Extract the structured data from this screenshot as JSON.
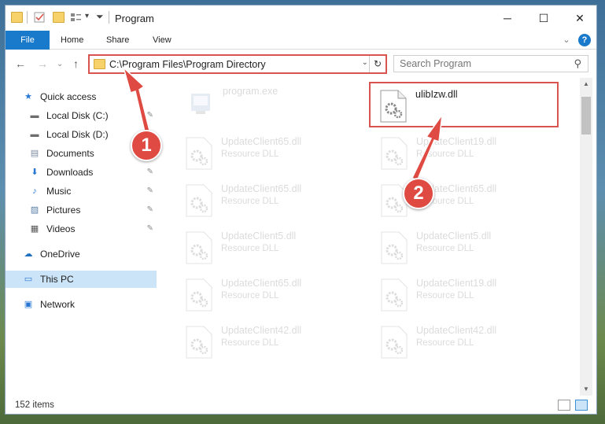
{
  "window": {
    "title": "Program",
    "controls": {
      "minimize": "─",
      "maximize": "☐",
      "close": "✕"
    }
  },
  "ribbon": {
    "tabs": [
      "File",
      "Home",
      "Share",
      "View"
    ],
    "help_label": "?",
    "collapse_label": "⌄"
  },
  "nav": {
    "back": "←",
    "forward": "→",
    "recent": "⌄",
    "up": "↑",
    "address": "C:\\Program Files\\Program Directory",
    "dropdown": "⌄",
    "refresh": "↻",
    "search_placeholder": "Search Program",
    "search_icon": "⚲"
  },
  "sidebar": {
    "items": [
      {
        "label": "Quick access",
        "icon": "star-icon",
        "glyph": "★",
        "color": "#2b78d4",
        "pinned": false
      },
      {
        "label": "Local Disk (C:)",
        "icon": "drive-icon",
        "glyph": "▬",
        "color": "#6d6d6d",
        "pinned": true
      },
      {
        "label": "Local Disk (D:)",
        "icon": "drive-icon",
        "glyph": "▬",
        "color": "#6d6d6d",
        "pinned": false
      },
      {
        "label": "Documents",
        "icon": "document-icon",
        "glyph": "▤",
        "color": "#7a8aa0",
        "pinned": true
      },
      {
        "label": "Downloads",
        "icon": "download-icon",
        "glyph": "⬇",
        "color": "#2b78d4",
        "pinned": true
      },
      {
        "label": "Music",
        "icon": "music-icon",
        "glyph": "♪",
        "color": "#2b78d4",
        "pinned": true
      },
      {
        "label": "Pictures",
        "icon": "pictures-icon",
        "glyph": "▨",
        "color": "#5a7fa8",
        "pinned": true
      },
      {
        "label": "Videos",
        "icon": "video-icon",
        "glyph": "▦",
        "color": "#555555",
        "pinned": true
      },
      {
        "label": "OneDrive",
        "icon": "cloud-icon",
        "glyph": "☁",
        "color": "#1f6fc0",
        "pinned": false
      },
      {
        "label": "This PC",
        "icon": "computer-icon",
        "glyph": "▭",
        "color": "#2b78d4",
        "pinned": false
      },
      {
        "label": "Network",
        "icon": "network-icon",
        "glyph": "▣",
        "color": "#2b78d4",
        "pinned": false
      }
    ],
    "pin_glyph": "✎"
  },
  "files": {
    "program": {
      "name": "program.exe"
    },
    "target": {
      "name": "ulibIzw.dll"
    },
    "left_column": [
      {
        "name": "UpdateClient65.dll",
        "desc": "Resource DLL"
      },
      {
        "name": "UpdateClient65.dll",
        "desc": "Resource DLL"
      },
      {
        "name": "UpdateClient5.dll",
        "desc": "Resource DLL"
      },
      {
        "name": "UpdateClient65.dll",
        "desc": "Resource DLL"
      },
      {
        "name": "UpdateClient42.dll",
        "desc": "Resource DLL"
      }
    ],
    "right_column": [
      {
        "name": "UpdateClient19.dll",
        "desc": "Resource DLL"
      },
      {
        "name": "UpdateClient65.dll",
        "desc": "Resource DLL"
      },
      {
        "name": "UpdateClient5.dll",
        "desc": "Resource DLL"
      },
      {
        "name": "UpdateClient19.dll",
        "desc": "Resource DLL"
      },
      {
        "name": "UpdateClient42.dll",
        "desc": "Resource DLL"
      }
    ]
  },
  "status": {
    "item_count": "152 items"
  },
  "callouts": [
    {
      "label": "1"
    },
    {
      "label": "2"
    }
  ],
  "colors": {
    "accent": "#1979ca",
    "highlight": "#d9534f",
    "callout": "#df4a42"
  }
}
